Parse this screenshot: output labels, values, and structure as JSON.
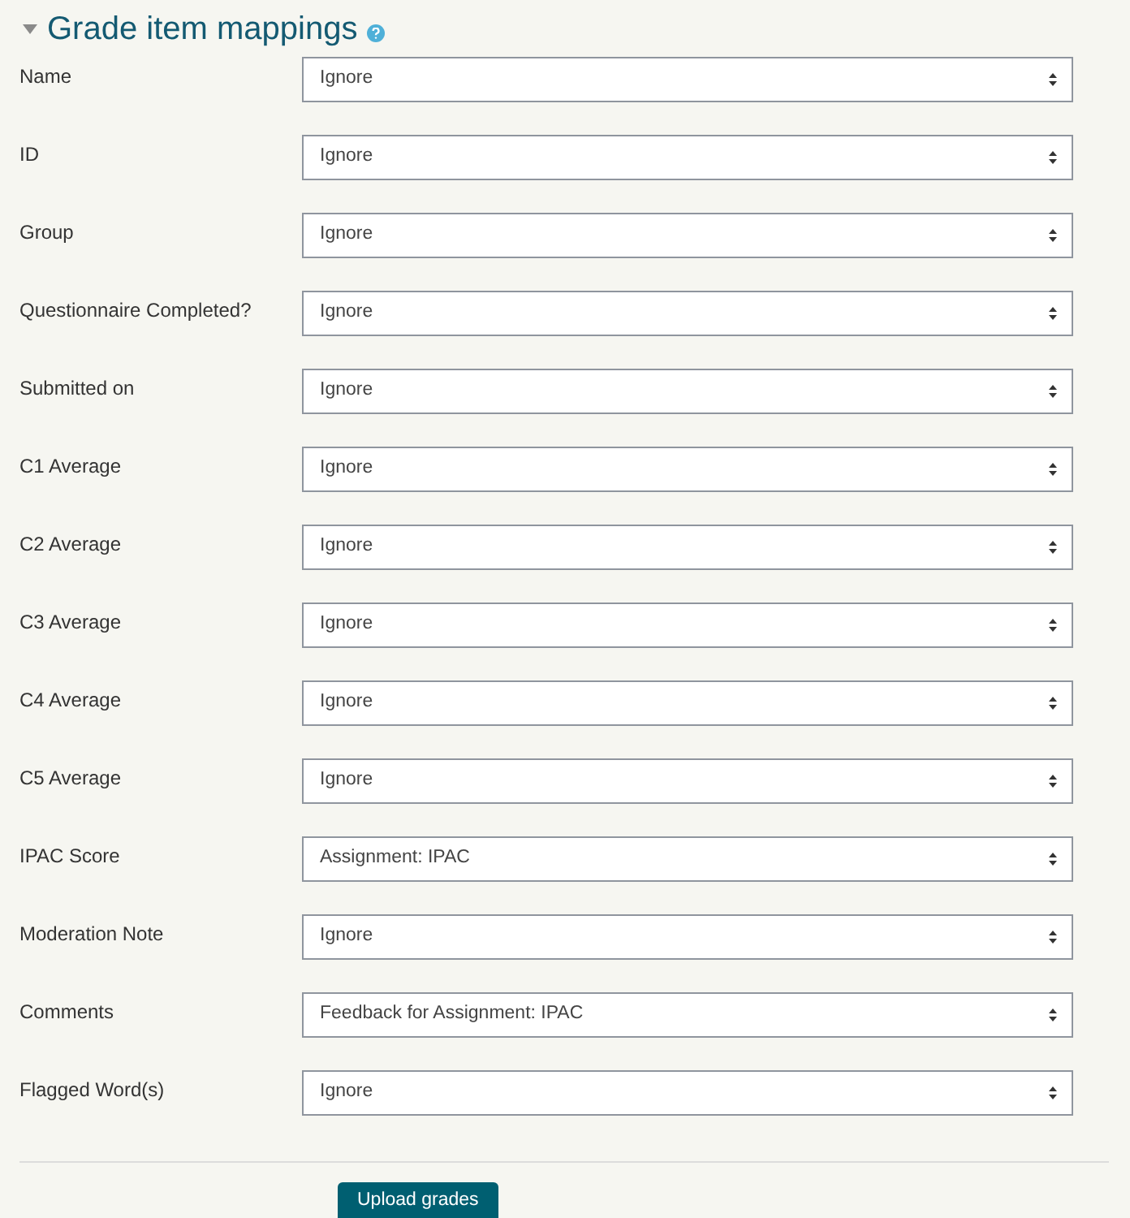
{
  "section": {
    "title": "Grade item mappings",
    "expanded": true
  },
  "mappings": [
    {
      "label": "Name",
      "value": "Ignore"
    },
    {
      "label": "ID",
      "value": "Ignore"
    },
    {
      "label": "Group",
      "value": "Ignore"
    },
    {
      "label": "Questionnaire Completed?",
      "value": "Ignore"
    },
    {
      "label": "Submitted on",
      "value": "Ignore"
    },
    {
      "label": "C1 Average",
      "value": "Ignore"
    },
    {
      "label": "C2 Average",
      "value": "Ignore"
    },
    {
      "label": "C3 Average",
      "value": "Ignore"
    },
    {
      "label": "C4 Average",
      "value": "Ignore"
    },
    {
      "label": "C5 Average",
      "value": "Ignore"
    },
    {
      "label": "IPAC Score",
      "value": "Assignment: IPAC"
    },
    {
      "label": "Moderation Note",
      "value": "Ignore"
    },
    {
      "label": "Comments",
      "value": "Feedback for Assignment: IPAC"
    },
    {
      "label": "Flagged Word(s)",
      "value": "Ignore"
    }
  ],
  "submit_button": "Upload grades"
}
